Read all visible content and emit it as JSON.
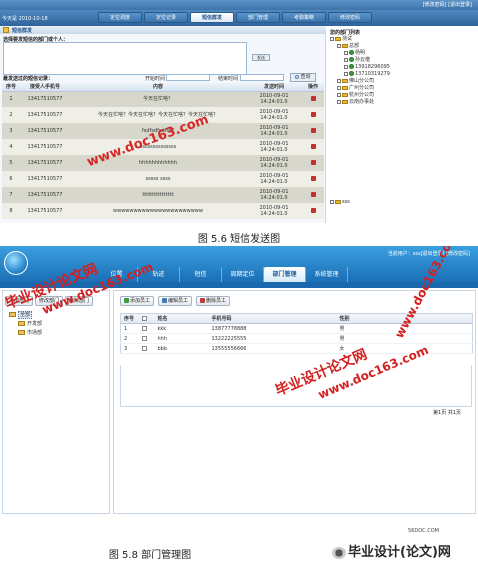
{
  "shot1": {
    "header_links": "[修改密码] [退出登录]",
    "date_prefix": "今天是",
    "date": "2010-10-18",
    "tabs": [
      "定位调度",
      "定位记录",
      "短信群发",
      "部门管理",
      "考勤策略",
      "修改密码"
    ],
    "active_tab": 2,
    "panel_title": "短信群发",
    "choose_label": "选择要发短信的部门或个人：",
    "send_button": "发送",
    "sent_records_label": "最发送过的短信记录：",
    "start_time_label": "开始时间",
    "end_time_label": "结束时间",
    "query_button": "查询",
    "table_headers": [
      "序号",
      "接受人手机号",
      "内容",
      "发送时间",
      "操作"
    ],
    "rows": [
      {
        "no": "1",
        "phone": "13417510577",
        "content": "今天在忙啥？",
        "time": "2010-09-01 14:24:01.0"
      },
      {
        "no": "2",
        "phone": "13417510577",
        "content": "今天在忙啥？今天在忙啥？今天在忙啥？今天在忙啥？",
        "time": "2010-09-01 14:24:01.0"
      },
      {
        "no": "3",
        "phone": "13417510577",
        "content": "fsdfsdfsdfsdf",
        "time": "2010-09-01 14:24:01.0"
      },
      {
        "no": "4",
        "phone": "13417510577",
        "content": "ssssssssssssss",
        "time": "2010-09-01 14:24:01.0"
      },
      {
        "no": "5",
        "phone": "13417510577",
        "content": "hhhhhhhhhhhh",
        "time": "2010-09-01 14:24:01.0"
      },
      {
        "no": "6",
        "phone": "13417510577",
        "content": "sssss ssss",
        "time": "2010-09-01 14:24:01.0"
      },
      {
        "no": "7",
        "phone": "13417510577",
        "content": "tttttttttttttttt",
        "time": "2010-09-01 14:24:01.0"
      },
      {
        "no": "8",
        "phone": "13417510577",
        "content": "wwwwwwwwwwwwwwwwwwwwww",
        "time": "2010-09-01 14:24:01.0"
      }
    ],
    "tree_title": "您的部门列表",
    "tree": [
      {
        "label": "测试",
        "kind": "folder",
        "indent": 0
      },
      {
        "label": "总部",
        "kind": "folder",
        "indent": 1
      },
      {
        "label": "杨明",
        "kind": "person",
        "indent": 2
      },
      {
        "label": "孙云楷",
        "kind": "person",
        "indent": 2
      },
      {
        "label": "13918296095",
        "kind": "person",
        "indent": 2
      },
      {
        "label": "13710319279",
        "kind": "person",
        "indent": 2
      },
      {
        "label": "佛山分公司",
        "kind": "folder",
        "indent": 1
      },
      {
        "label": "广州分公司",
        "kind": "folder",
        "indent": 1
      },
      {
        "label": "杭州分公司",
        "kind": "folder",
        "indent": 1
      },
      {
        "label": "云南办事处",
        "kind": "folder",
        "indent": 1
      }
    ],
    "tree_footer": "sss",
    "watermark": "www.doc163.com",
    "caption": "图 5.6  短信发送图"
  },
  "shot2": {
    "userinfo": "当前用户：sss[退出登录] [修改密码]",
    "nav": [
      "位置",
      "轨迹",
      "短信",
      "周期定位",
      "部门管理",
      "系统管理"
    ],
    "active_nav": 4,
    "left_buttons": [
      "添加部门",
      "修改部门",
      "删除部门"
    ],
    "dept_tree": [
      {
        "label": "全部",
        "root": true
      },
      {
        "label": "开发部",
        "root": false
      },
      {
        "label": "市场部",
        "root": false
      }
    ],
    "main_buttons": [
      "添加员工",
      "编辑员工",
      "删除员工"
    ],
    "table_headers": [
      "序号",
      "",
      "姓名",
      "手机号码",
      "性别"
    ],
    "rows": [
      {
        "no": "1",
        "name": "kkk",
        "phone": "13877778888",
        "gender": "男"
      },
      {
        "no": "2",
        "name": "hhh",
        "phone": "13222225555",
        "gender": "男"
      },
      {
        "no": "3",
        "name": "bbb",
        "phone": "13555556666",
        "gender": "女"
      }
    ],
    "pager": "第1页 共1页",
    "watermark_cn": "毕业设计论文网",
    "watermark_url": "www.doc163.com",
    "caption": "图 5.8  部门管理图"
  },
  "footer": {
    "site": "56DOC.COM",
    "logo_text": "毕业设计(论文)网"
  },
  "colors": {
    "watermark": "#d42020",
    "header_blue": "#1b6fb6",
    "row_odd": "#d7d7cb"
  }
}
